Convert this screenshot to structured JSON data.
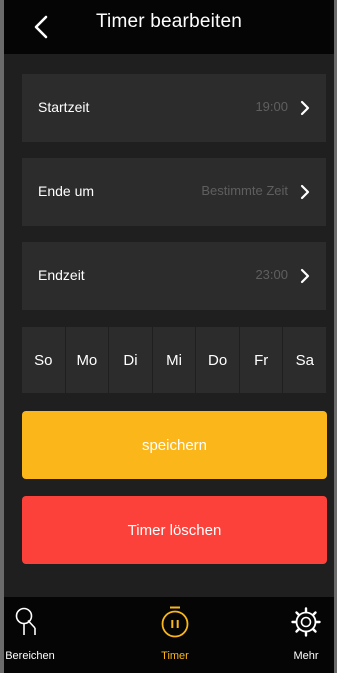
{
  "header": {
    "title": "Timer bearbeiten",
    "back_icon": "chevron-left-icon"
  },
  "settings": [
    {
      "label": "Startzeit",
      "value": "19:00"
    },
    {
      "label": "Ende um",
      "value": "Bestimmte Zeit"
    },
    {
      "label": "Endzeit",
      "value": "23:00"
    }
  ],
  "weekdays": [
    "So",
    "Mo",
    "Di",
    "Mi",
    "Do",
    "Fr",
    "Sa"
  ],
  "buttons": {
    "save_label": "speichern",
    "delete_label": "Timer löschen"
  },
  "tabbar": {
    "items": [
      {
        "label": "Bereichen",
        "icon": "areas-icon"
      },
      {
        "label": "Timer",
        "icon": "timer-icon",
        "active": true
      },
      {
        "label": "Mehr",
        "icon": "gear-icon"
      }
    ]
  },
  "colors": {
    "accent": "#fbb61a",
    "danger": "#fc413a",
    "row_background": "#2c2c2c",
    "background": "#1f1f1f",
    "bar_background": "#050505"
  }
}
